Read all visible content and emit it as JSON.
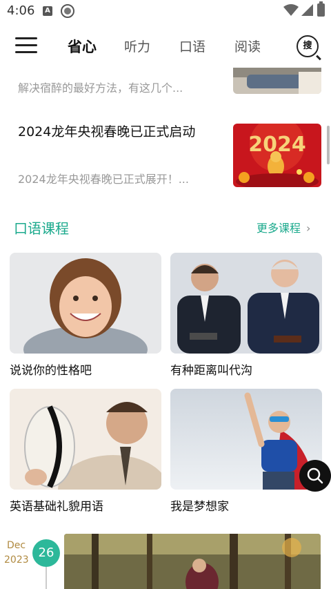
{
  "status_bar": {
    "time": "4:06",
    "a_badge": "A"
  },
  "header": {
    "tabs": [
      {
        "label": "省心",
        "active": true
      },
      {
        "label": "听力",
        "active": false
      },
      {
        "label": "口语",
        "active": false
      },
      {
        "label": "阅读",
        "active": false
      }
    ],
    "search_label": "搜"
  },
  "news": [
    {
      "title": "",
      "desc": "解决宿醉的最好方法，有这几个..."
    },
    {
      "title": "2024龙年央视春晚已正式启动",
      "desc": "2024龙年央视春晚已正式展开！..."
    }
  ],
  "thumb_text": "2024",
  "spoken": {
    "section_title": "口语课程",
    "more_label": "更多课程",
    "more_chevron": "›",
    "courses": [
      {
        "title": "说说你的性格吧"
      },
      {
        "title": "有种距离叫代沟"
      },
      {
        "title": "英语基础礼貌用语"
      },
      {
        "title": "我是梦想家"
      }
    ]
  },
  "timeline": {
    "month": "Dec",
    "year": "2023",
    "day": "26"
  },
  "colors": {
    "accent": "#1aa98c",
    "day_badge": "#2db89a",
    "date_text": "#b08a40"
  }
}
